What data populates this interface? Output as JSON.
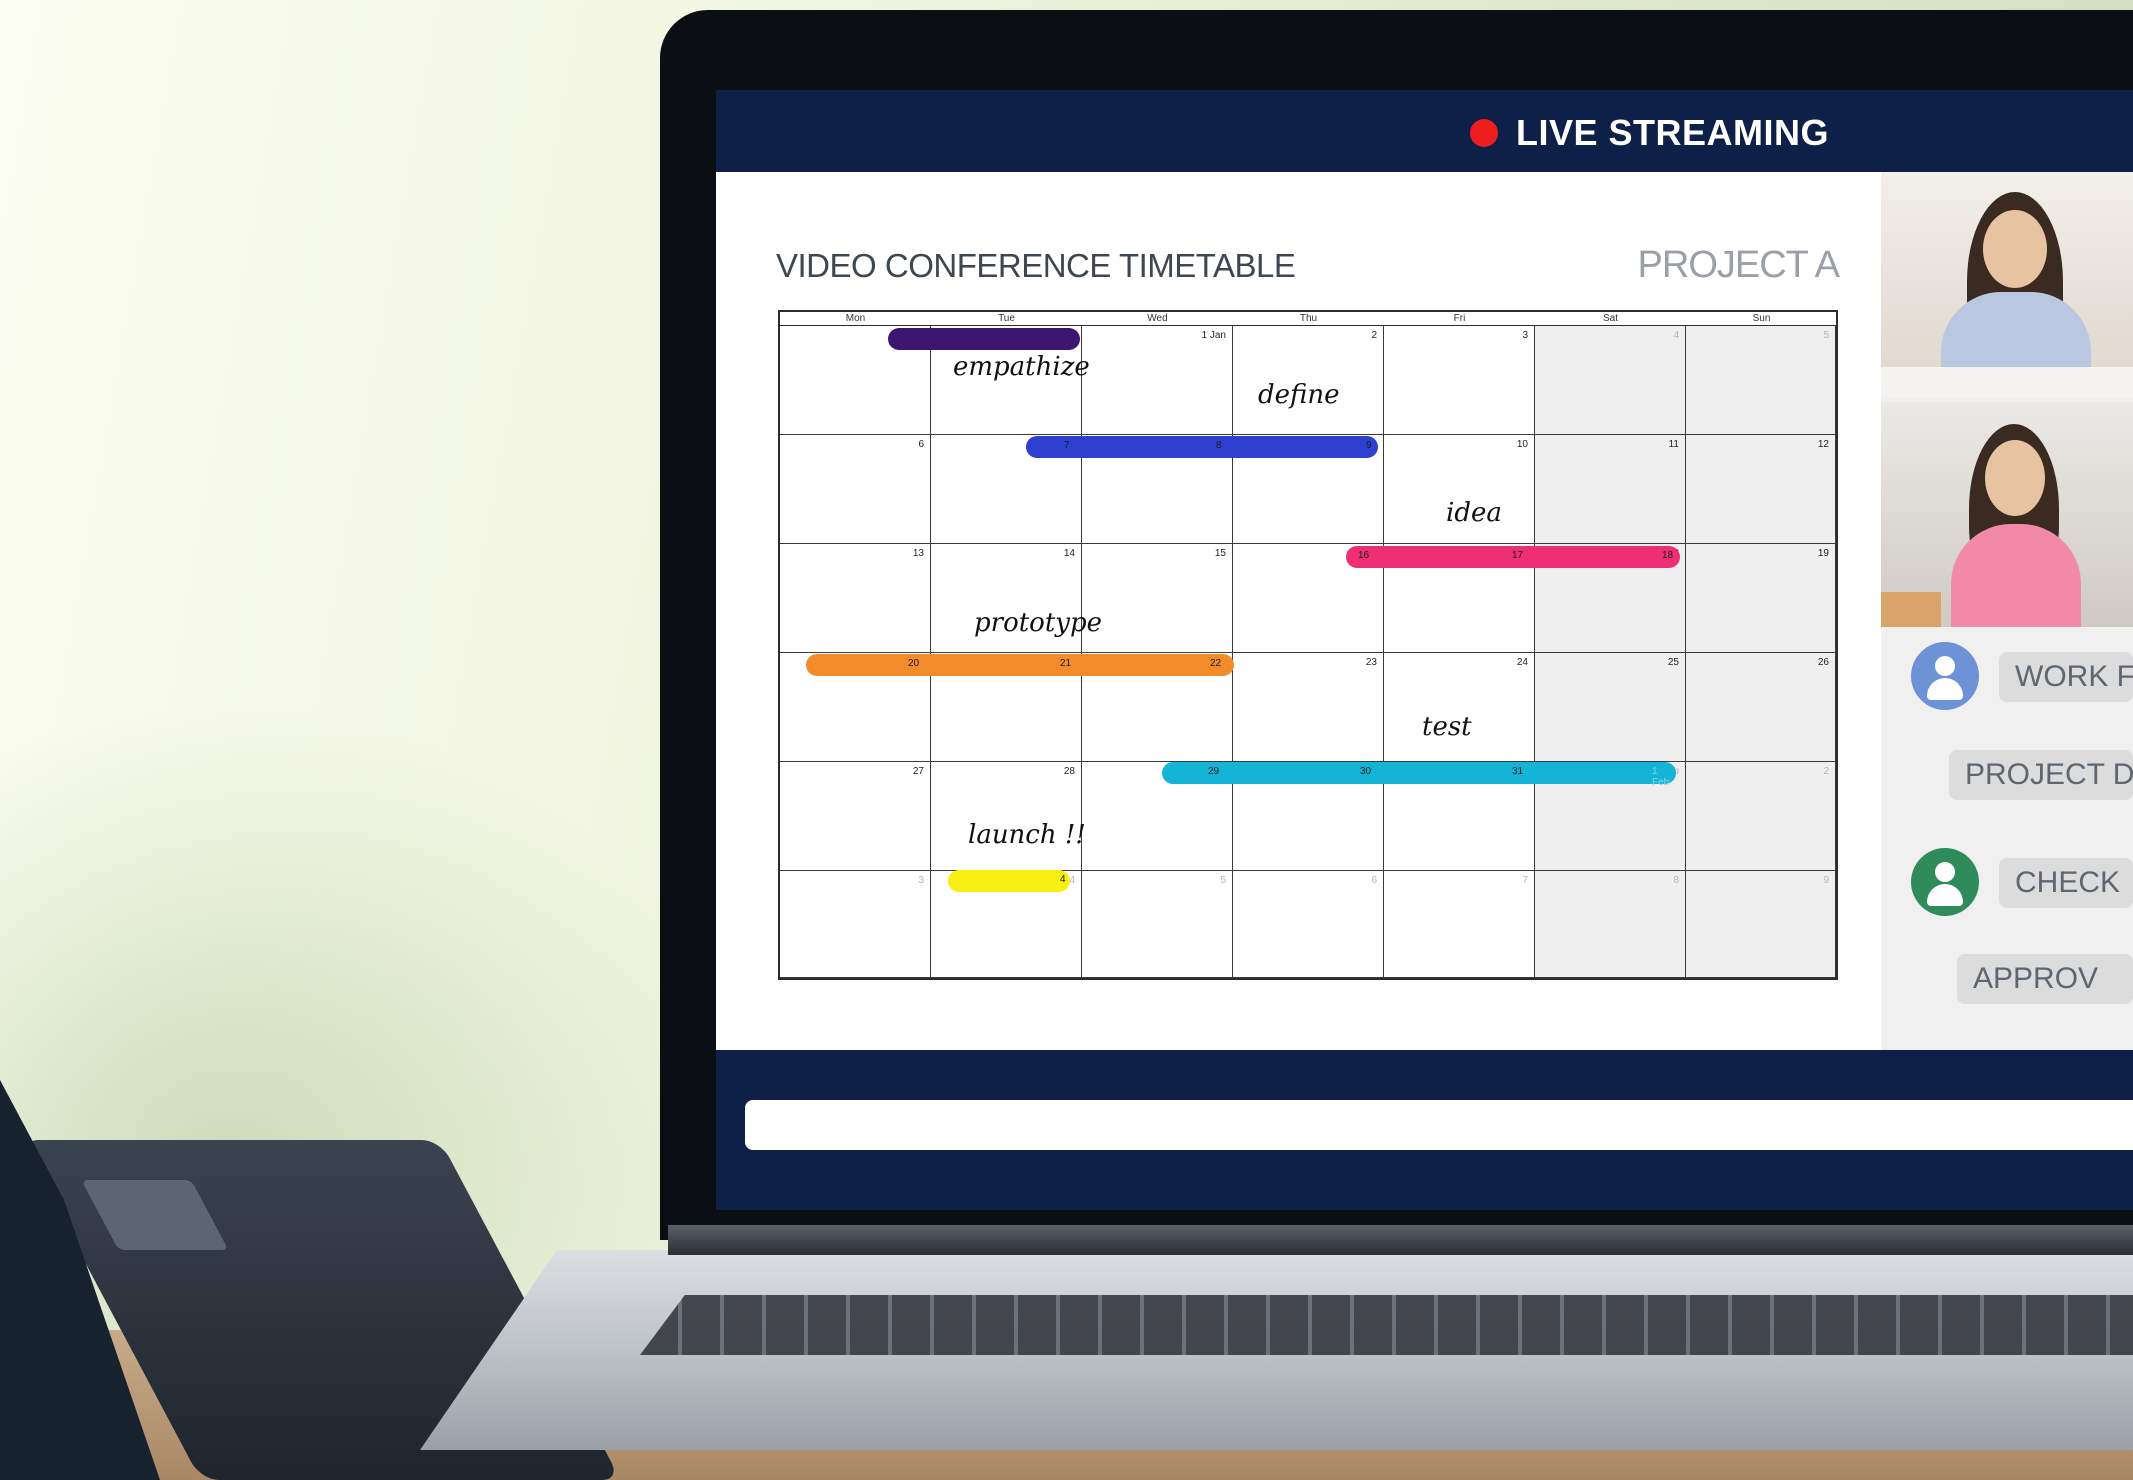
{
  "header": {
    "live_label": "LIVE STREAMING",
    "live_dot_color": "#ef1e1e"
  },
  "timetable": {
    "title": "VIDEO CONFERENCE TIMETABLE",
    "project": "PROJECT A",
    "day_names": [
      "Mon",
      "Tue",
      "Wed",
      "Thu",
      "Fri",
      "Sat",
      "Sun"
    ],
    "weeks": [
      [
        "",
        "",
        "1 Jan",
        "2",
        "3",
        "4",
        "5"
      ],
      [
        "6",
        "7",
        "8",
        "9",
        "10",
        "11",
        "12"
      ],
      [
        "13",
        "14",
        "15",
        "16",
        "17",
        "18",
        "19"
      ],
      [
        "20",
        "21",
        "22",
        "23",
        "24",
        "25",
        "26"
      ],
      [
        "27",
        "28",
        "29",
        "30",
        "31",
        "1 Feb",
        "2"
      ],
      [
        "3",
        "4",
        "5",
        "6",
        "7",
        "8",
        "9"
      ]
    ],
    "phases": [
      {
        "label": "empathize",
        "color": "#3d1670"
      },
      {
        "label": "define",
        "color": "#2f3fd0"
      },
      {
        "label": "idea",
        "color": "#ee2f73"
      },
      {
        "label": "prototype",
        "color": "#f28c2a"
      },
      {
        "label": "test",
        "color": "#14b4d6"
      },
      {
        "label": "launch !!",
        "color": "#f7ee12"
      }
    ]
  },
  "chat": {
    "messages": [
      {
        "text": "WORK F",
        "avatar_color": "#6d93d6"
      },
      {
        "text": "PROJECT D"
      },
      {
        "text": "CHECK",
        "avatar_color": "#2f8b5a"
      },
      {
        "text": "APPROV"
      }
    ]
  }
}
